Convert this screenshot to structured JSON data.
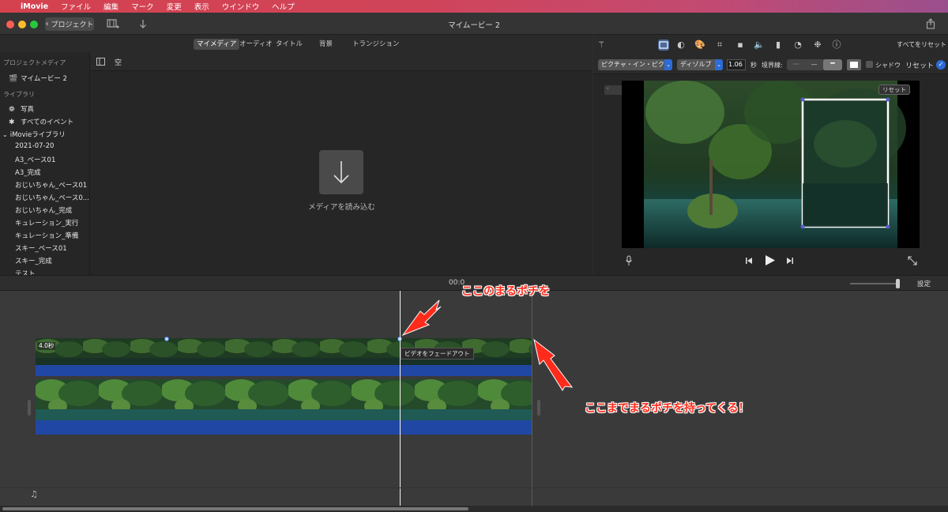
{
  "menubar": {
    "app_name": "iMovie",
    "items": [
      "ファイル",
      "編集",
      "マーク",
      "変更",
      "表示",
      "ウインドウ",
      "ヘルプ"
    ]
  },
  "titlebar": {
    "back_button_label": "プロジェクト",
    "window_title": "マイムービー 2"
  },
  "browser": {
    "tabs": [
      "マイメディア",
      "オーディオ",
      "タイトル",
      "背景",
      "トランジション"
    ],
    "active_tab": "マイメディア",
    "sidebar": {
      "project_media_header": "プロジェクトメディア",
      "project_item": "マイムービー 2",
      "library_header": "ライブラリ",
      "photos_item": "写真",
      "all_events_item": "すべてのイベント",
      "imovie_library_item": "iMovieライブラリ",
      "events": [
        "2021-07-20",
        "A3_ベース01",
        "A3_完成",
        "おじいちゃん_ベース01",
        "おじいちゃん_ベース0...",
        "おじいちゃん_完成",
        "キュレーション_実行",
        "キュレーション_準備",
        "スキー_ベース01",
        "スキー_完成",
        "テスト"
      ]
    },
    "content_filter": "空",
    "import_label": "メディアを読み込む"
  },
  "viewer": {
    "reset_all_label": "すべてをリセット",
    "style_dropdown": "ピクチャ・イン・ピク...",
    "transition_dropdown": "ディゾルブ",
    "duration_value": "1.06",
    "duration_unit": "秒",
    "border_label": "境界線:",
    "shadow_label": "シャドウ",
    "reset_label": "リセット",
    "overlay_reset_label": "リセット"
  },
  "timeline": {
    "timecode": "00:0",
    "settings_label": "設定",
    "clip_duration_badge": "4.0秒",
    "fade_tooltip": "ビデオをフェードアウト"
  },
  "annotations": {
    "top_note": "ここのまるポチを",
    "right_note": "ここまでまるポチを持ってくる！"
  },
  "colors": {
    "accent_blue": "#2d6bd6",
    "clip_blue": "#2147a4",
    "annotation_red": "#ff2b1a",
    "menubar_start": "#d4424f",
    "menubar_end": "#9a4f8d"
  }
}
